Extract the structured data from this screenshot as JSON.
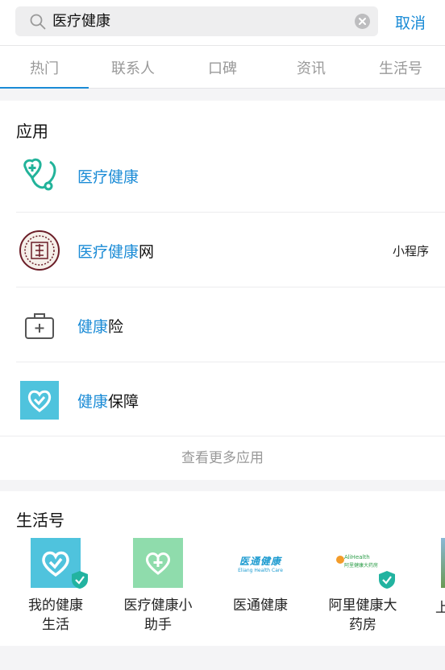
{
  "search": {
    "query": "医疗健康",
    "cancel_label": "取消"
  },
  "tabs": [
    "热门",
    "联系人",
    "口碑",
    "资讯",
    "生活号"
  ],
  "apps": {
    "title": "应用",
    "items": [
      {
        "highlight": "医疗健康",
        "rest": "",
        "badge": ""
      },
      {
        "highlight": "医疗健康",
        "rest": "网",
        "badge": "小程序"
      },
      {
        "highlight": "健康",
        "rest": "险",
        "badge": ""
      },
      {
        "highlight": "健康",
        "rest": "保障",
        "badge": ""
      }
    ],
    "more_label": "查看更多应用"
  },
  "life": {
    "title": "生活号",
    "items": [
      {
        "line1": "我的健康",
        "line2": "生活"
      },
      {
        "line1": "医疗健康小",
        "line2": "助手"
      },
      {
        "line1": "医通健康",
        "line2": ""
      },
      {
        "line1": "阿里健康大",
        "line2": "药房"
      },
      {
        "line1": "上",
        "line2": ""
      }
    ],
    "logo_texts": {
      "yitong": "医通健康",
      "yitong_sub": "Eliang Health Care",
      "ali": "AliHealth",
      "ali_sub": "阿里健康大药房"
    }
  },
  "colors": {
    "accent": "#1a8bd6",
    "teal": "#22b39a",
    "card_blue": "#4fc3dd",
    "mint": "#8fdcac"
  }
}
